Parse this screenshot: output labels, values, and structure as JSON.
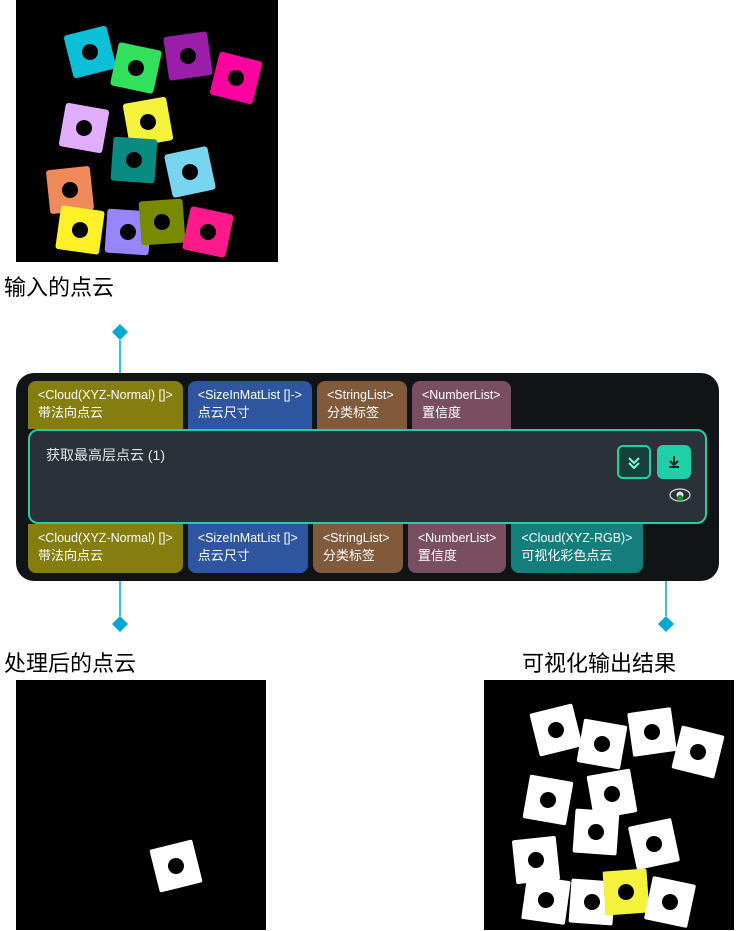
{
  "captions": {
    "input": "输入的点云",
    "processed": "处理后的点云",
    "visual": "可视化输出结果"
  },
  "node": {
    "title": "获取最高层点云 (1)",
    "inputs": [
      {
        "type": "<Cloud(XYZ-Normal) []>",
        "label": "带法向点云",
        "color": "olive"
      },
      {
        "type": "<SizeInMatList []->",
        "label": "点云尺寸",
        "color": "blue"
      },
      {
        "type": "<StringList>",
        "label": "分类标签",
        "color": "brown"
      },
      {
        "type": "<NumberList>",
        "label": "置信度",
        "color": "plum"
      }
    ],
    "outputs": [
      {
        "type": "<Cloud(XYZ-Normal) []>",
        "label": "带法向点云",
        "color": "olive"
      },
      {
        "type": "<SizeInMatList []>",
        "label": "点云尺寸",
        "color": "blue"
      },
      {
        "type": "<StringList>",
        "label": "分类标签",
        "color": "brown"
      },
      {
        "type": "<NumberList>",
        "label": "置信度",
        "color": "plum"
      },
      {
        "type": "<Cloud(XYZ-RGB)>",
        "label": "可视化彩色点云",
        "color": "teal"
      }
    ],
    "buttons": {
      "down": "down-button",
      "import": "import-button",
      "eye": "visibility-eye"
    }
  }
}
